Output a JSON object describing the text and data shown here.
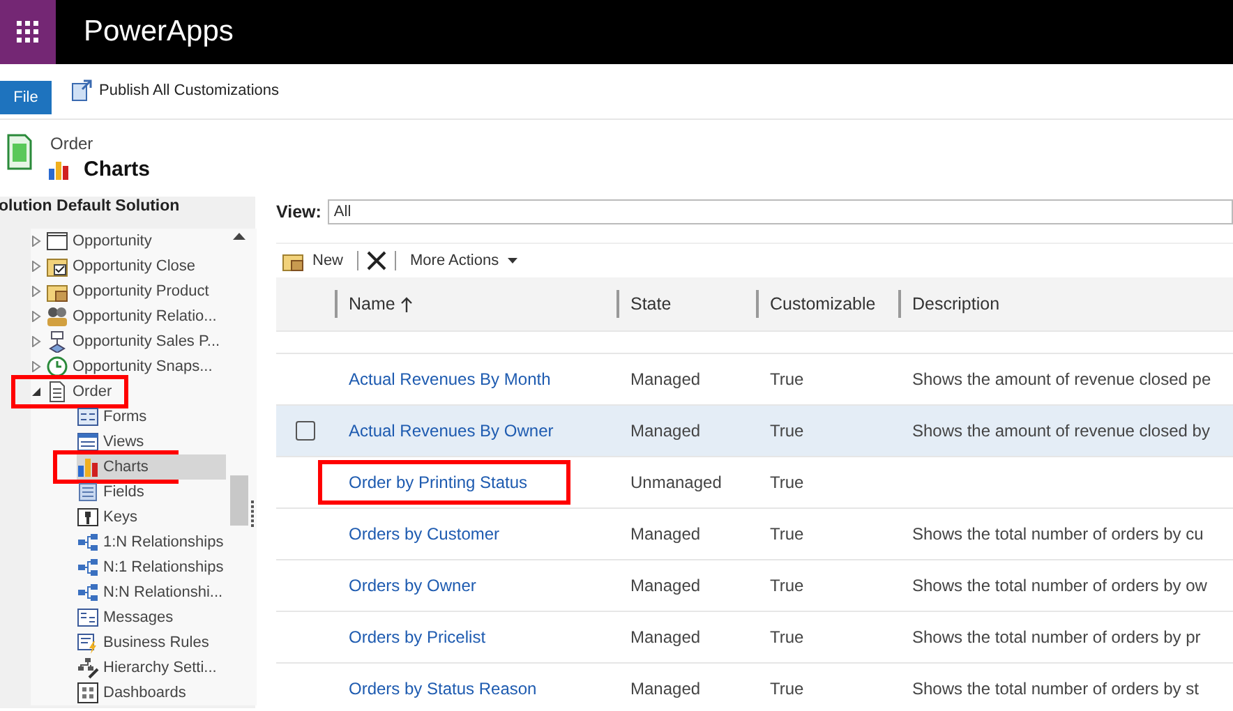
{
  "app": {
    "title": "PowerApps"
  },
  "ribbon": {
    "file_tab": "File",
    "publish_button": "Publish All Customizations"
  },
  "header": {
    "entity": "Order",
    "component": "Charts"
  },
  "solution_title": "olution Default Solution",
  "tree": [
    {
      "label": "Opportunity",
      "kind": "entity",
      "expanded": false,
      "highlighted": false
    },
    {
      "label": "Opportunity Close",
      "kind": "activity",
      "expanded": false,
      "highlighted": false
    },
    {
      "label": "Opportunity Product",
      "kind": "product",
      "expanded": false,
      "highlighted": false
    },
    {
      "label": "Opportunity Relatio...",
      "kind": "people",
      "expanded": false,
      "highlighted": false
    },
    {
      "label": "Opportunity Sales P...",
      "kind": "process",
      "expanded": false,
      "highlighted": false
    },
    {
      "label": "Opportunity Snaps...",
      "kind": "clock",
      "expanded": false,
      "highlighted": false
    },
    {
      "label": "Order",
      "kind": "document",
      "expanded": true,
      "highlighted": true,
      "children": [
        {
          "label": "Forms",
          "kind": "form",
          "selected": false,
          "highlighted": false
        },
        {
          "label": "Views",
          "kind": "view",
          "selected": false,
          "highlighted": false
        },
        {
          "label": "Charts",
          "kind": "chart",
          "selected": true,
          "highlighted": true
        },
        {
          "label": "Fields",
          "kind": "fields",
          "selected": false,
          "highlighted": false
        },
        {
          "label": "Keys",
          "kind": "key",
          "selected": false,
          "highlighted": false
        },
        {
          "label": "1:N Relationships",
          "kind": "relation",
          "selected": false,
          "highlighted": false
        },
        {
          "label": "N:1 Relationships",
          "kind": "relation",
          "selected": false,
          "highlighted": false
        },
        {
          "label": "N:N Relationshi...",
          "kind": "relation",
          "selected": false,
          "highlighted": false
        },
        {
          "label": "Messages",
          "kind": "message",
          "selected": false,
          "highlighted": false
        },
        {
          "label": "Business Rules",
          "kind": "rule",
          "selected": false,
          "highlighted": false
        },
        {
          "label": "Hierarchy Setti...",
          "kind": "hierarchy",
          "selected": false,
          "highlighted": false
        },
        {
          "label": "Dashboards",
          "kind": "dashboard",
          "selected": false,
          "highlighted": false
        }
      ]
    }
  ],
  "view": {
    "label": "View:",
    "value": "All"
  },
  "toolbar": {
    "new_button": "New",
    "more_actions": "More Actions"
  },
  "table": {
    "columns": [
      {
        "label": "Name",
        "sorted": true
      },
      {
        "label": "State",
        "sorted": false
      },
      {
        "label": "Customizable",
        "sorted": false
      },
      {
        "label": "Description",
        "sorted": false
      }
    ],
    "rows": [
      {
        "name": "Actual Revenues By Month",
        "state": "Managed",
        "customizable": "True",
        "description": "Shows the amount of revenue closed pe",
        "hovered": false,
        "highlighted": false
      },
      {
        "name": "Actual Revenues By Owner",
        "state": "Managed",
        "customizable": "True",
        "description": "Shows the amount of revenue closed by",
        "hovered": true,
        "highlighted": false
      },
      {
        "name": "Order by Printing Status",
        "state": "Unmanaged",
        "customizable": "True",
        "hovered": false,
        "highlighted": true
      },
      {
        "name": "Orders by Customer",
        "state": "Managed",
        "customizable": "True",
        "description": "Shows the total number of orders by cu",
        "hovered": false,
        "highlighted": false
      },
      {
        "name": "Orders by Owner",
        "state": "Managed",
        "customizable": "True",
        "description": "Shows the total number of orders by ow",
        "hovered": false,
        "highlighted": false
      },
      {
        "name": "Orders by Pricelist",
        "state": "Managed",
        "customizable": "True",
        "description": "Shows the total number of orders by pr",
        "hovered": false,
        "highlighted": false
      },
      {
        "name": "Orders by Status Reason",
        "state": "Managed",
        "customizable": "True",
        "description": "Shows the total number of orders by st",
        "hovered": false,
        "highlighted": false
      }
    ]
  }
}
